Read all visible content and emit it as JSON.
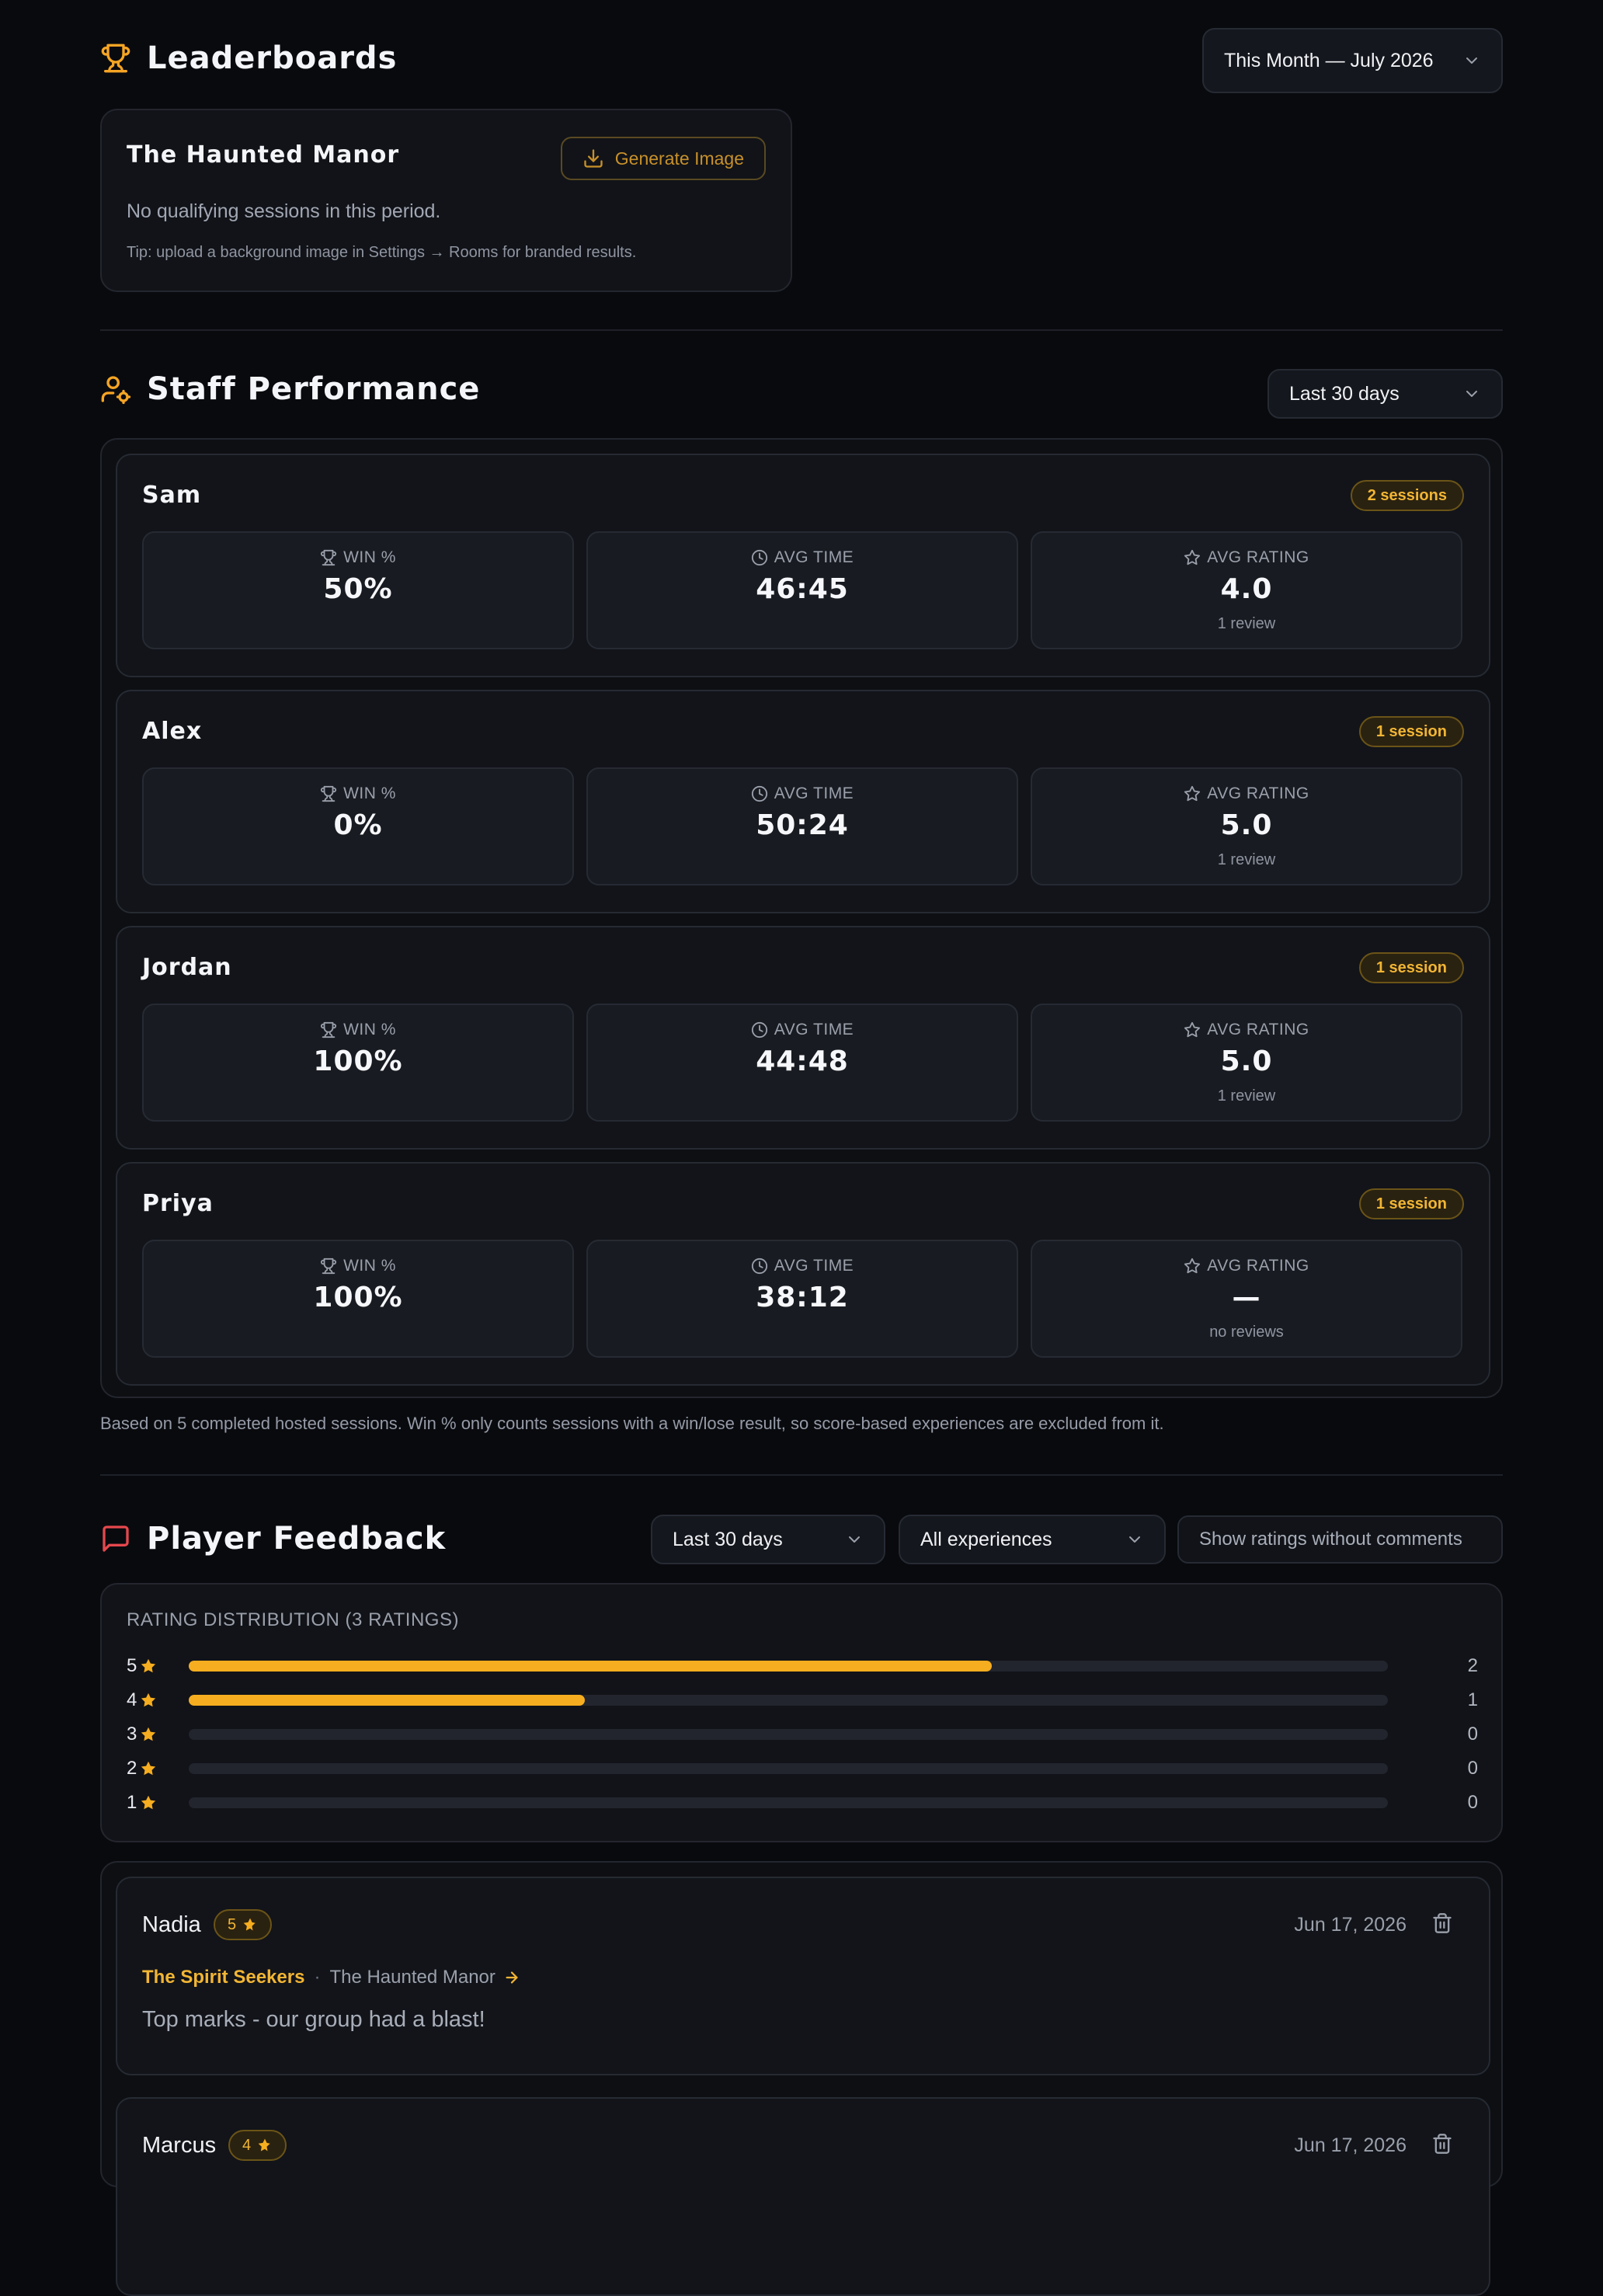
{
  "leaderboards": {
    "title": "Leaderboards",
    "period_select": "This Month — July 2026",
    "card": {
      "room": "The Haunted Manor",
      "generate_label": "Generate Image",
      "empty_message": "No qualifying sessions in this period.",
      "tip": "Tip: upload a background image in Settings → Rooms for branded results."
    }
  },
  "staff": {
    "title": "Staff Performance",
    "range_select": "Last 30 days",
    "labels": {
      "win": "WIN %",
      "time": "AVG TIME",
      "rating": "AVG RATING"
    },
    "members": [
      {
        "name": "Sam",
        "sessions": "2 sessions",
        "win": "50%",
        "time": "46:45",
        "rating": "4.0",
        "reviews": "1 review"
      },
      {
        "name": "Alex",
        "sessions": "1 session",
        "win": "0%",
        "time": "50:24",
        "rating": "5.0",
        "reviews": "1 review"
      },
      {
        "name": "Jordan",
        "sessions": "1 session",
        "win": "100%",
        "time": "44:48",
        "rating": "5.0",
        "reviews": "1 review"
      },
      {
        "name": "Priya",
        "sessions": "1 session",
        "win": "100%",
        "time": "38:12",
        "rating": "—",
        "reviews": "no reviews"
      }
    ],
    "footnote": "Based on 5 completed hosted sessions. Win % only counts sessions with a win/lose result, so score-based experiences are excluded from it."
  },
  "feedback": {
    "title": "Player Feedback",
    "range_select": "Last 30 days",
    "experience_select": "All experiences",
    "toggle_label": "Show ratings without comments",
    "distribution": {
      "title": "RATING DISTRIBUTION (3 RATINGS)",
      "rows": [
        {
          "stars": "5",
          "count": "2",
          "fraction": 0.67
        },
        {
          "stars": "4",
          "count": "1",
          "fraction": 0.33
        },
        {
          "stars": "3",
          "count": "0",
          "fraction": 0
        },
        {
          "stars": "2",
          "count": "0",
          "fraction": 0
        },
        {
          "stars": "1",
          "count": "0",
          "fraction": 0
        }
      ]
    },
    "items": [
      {
        "name": "Nadia",
        "rating": "5",
        "date": "Jun 17, 2026",
        "team": "The Spirit Seekers",
        "room": "The Haunted Manor",
        "comment": "Top marks - our group had a blast!"
      },
      {
        "name": "Marcus",
        "rating": "4",
        "date": "Jun 17, 2026"
      }
    ]
  },
  "colors": {
    "accent": "#f6ad1f",
    "background": "#090a0e",
    "card": "#111318",
    "feedback_icon": "#e5484d"
  }
}
